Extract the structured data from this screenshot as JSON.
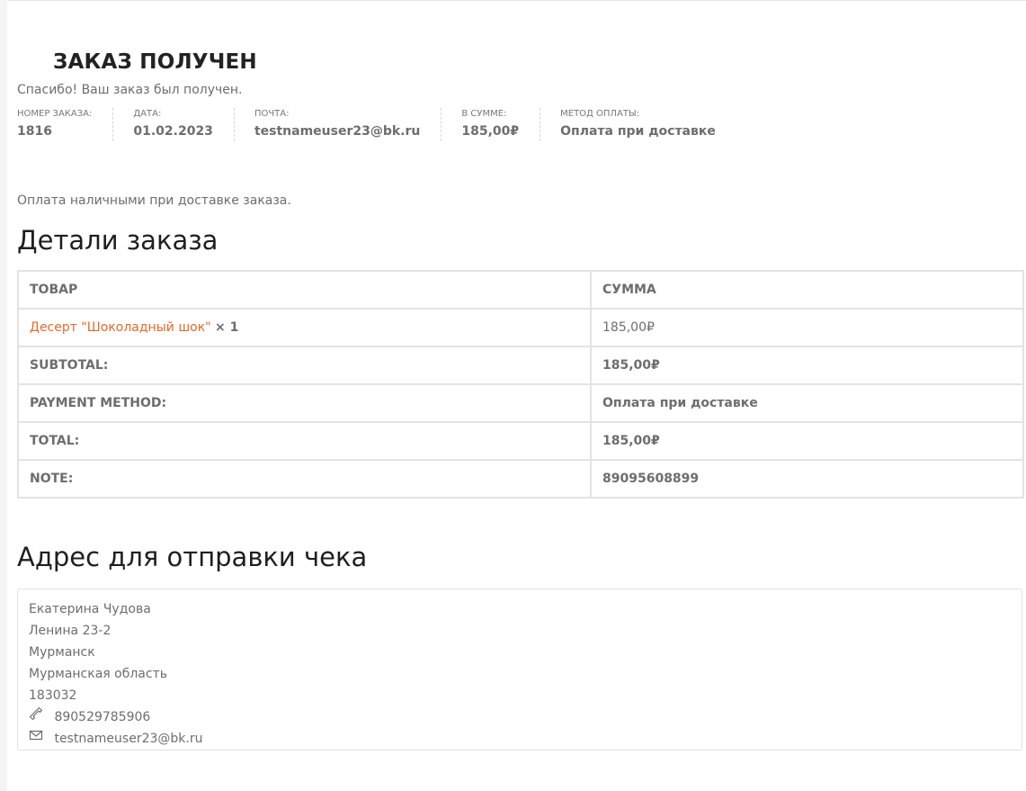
{
  "page_title": "ЗАКАЗ ПОЛУЧЕН",
  "thank_you": "Спасибо! Ваш заказ был получен.",
  "overview": [
    {
      "label": "НОМЕР ЗАКАЗА:",
      "value": "1816"
    },
    {
      "label": "ДАТА:",
      "value": "01.02.2023"
    },
    {
      "label": "ПОЧТА:",
      "value": "testnameuser23@bk.ru"
    },
    {
      "label": "В СУММЕ:",
      "value": "185,00₽"
    },
    {
      "label": "МЕТОД ОПЛАТЫ:",
      "value": "Оплата при доставке"
    }
  ],
  "payment_note": "Оплата наличными при доставке заказа.",
  "details": {
    "heading": "Детали заказа",
    "header": {
      "product": "ТОВАР",
      "sum": "СУММА"
    },
    "item": {
      "name": "Десерт \"Шоколадный шок\"",
      "qty": "× 1",
      "price": "185,00₽"
    },
    "rows": [
      {
        "label": "SUBTOTAL:",
        "value": "185,00₽"
      },
      {
        "label": "PAYMENT METHOD:",
        "value": "Оплата при доставке"
      },
      {
        "label": "TOTAL:",
        "value": "185,00₽"
      },
      {
        "label": "NOTE:",
        "value": "89095608899"
      }
    ]
  },
  "address": {
    "heading": "Адрес для отправки чека",
    "name": "Екатерина Чудова",
    "street": "Ленина 23-2",
    "city": "Мурманск",
    "region": "Мурманская область",
    "postcode": "183032",
    "phone": "890529785906",
    "email": "testnameuser23@bk.ru",
    "phone_icon": "phone-icon",
    "email_icon": "envelope-icon"
  },
  "colors": {
    "link": "#e5692a",
    "text": "#6d6d6d",
    "heading": "#1f1f1f"
  }
}
